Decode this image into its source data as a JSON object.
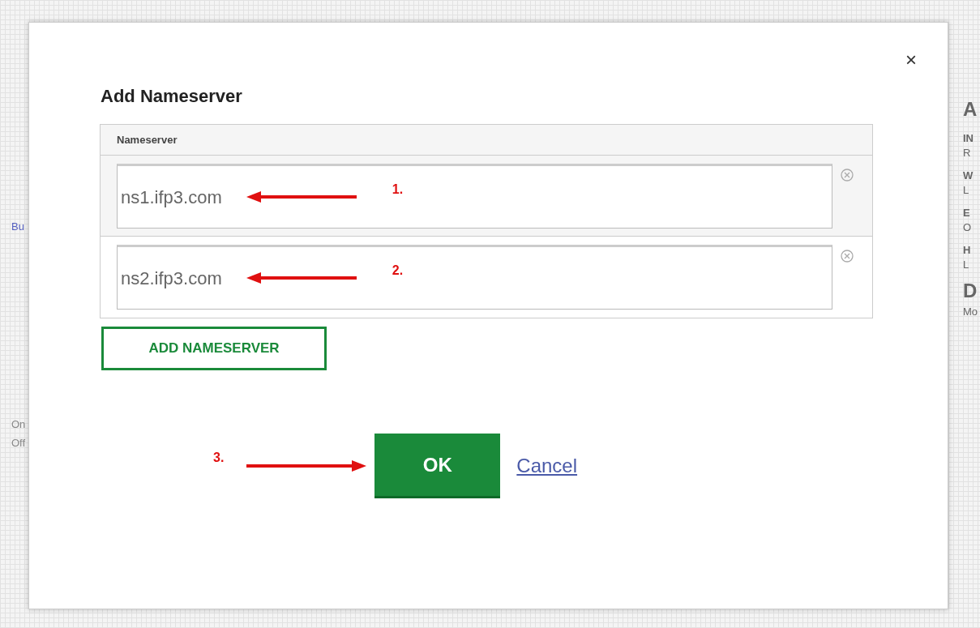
{
  "background": {
    "left_fragments": [
      "Bu",
      "On",
      "Off"
    ],
    "right_fragments": [
      "A",
      "IN",
      "R",
      "W",
      "L",
      "E",
      "O",
      "H",
      "L",
      "D",
      "Mo"
    ]
  },
  "dialog": {
    "title": "Add Nameserver",
    "close": "×",
    "table": {
      "column": "Nameserver",
      "rows": [
        {
          "value": "ns1.ifp3.com",
          "annotation": "1."
        },
        {
          "value": "ns2.ifp3.com",
          "annotation": "2."
        }
      ]
    },
    "add_button": "ADD NAMESERVER",
    "ok_annotation": "3.",
    "ok": "OK",
    "cancel": "Cancel"
  }
}
